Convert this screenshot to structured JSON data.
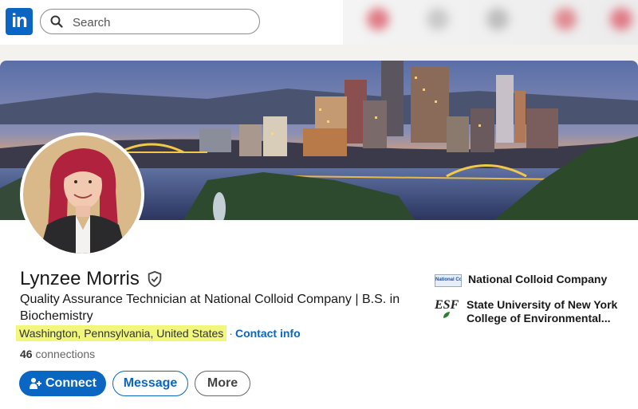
{
  "nav": {
    "logo_text": "in",
    "search_placeholder": "Search"
  },
  "profile": {
    "name": "Lynzee Morris",
    "headline": "Quality Assurance Technician at National Colloid Company | B.S. in Biochemistry",
    "location": "Washington, Pennsylvania, United States",
    "separator": "·",
    "contact_info": "Contact info",
    "connections_count": "46",
    "connections_label": "connections"
  },
  "actions": {
    "connect": "Connect",
    "message": "Message",
    "more": "More"
  },
  "experience": {
    "company": "National Colloid Company",
    "company_logo_text": "National Colloid"
  },
  "education": {
    "school_line1": "State University of New York",
    "school_line2": "College of Environmental...",
    "school_logo_text": "ESF"
  },
  "colors": {
    "brand": "#0a66c2",
    "highlight": "#f1f77a"
  }
}
